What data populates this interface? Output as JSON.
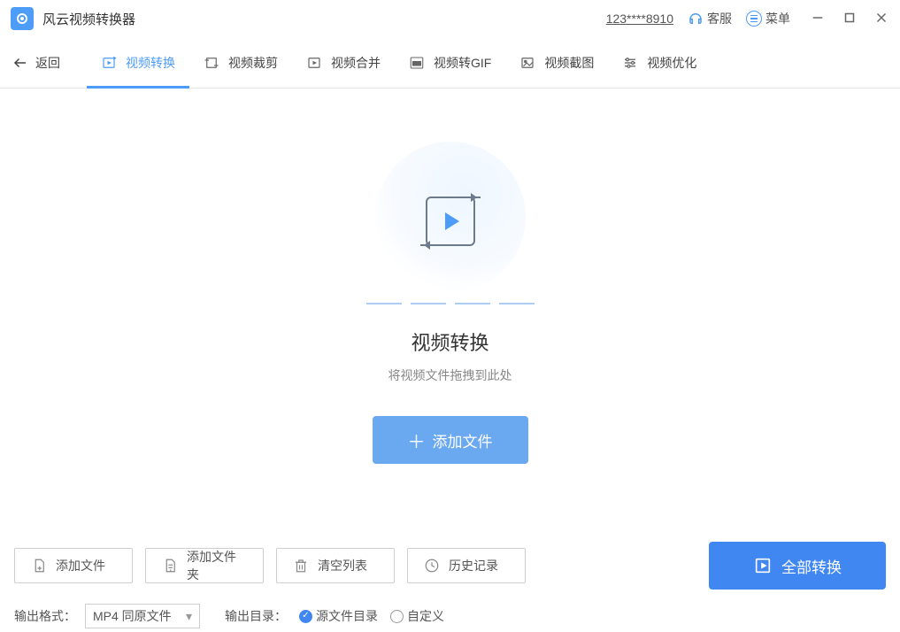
{
  "titlebar": {
    "app_name": "风云视频转换器",
    "account": "123****8910",
    "support": "客服",
    "menu": "菜单"
  },
  "tabs": {
    "back": "返回",
    "items": [
      {
        "label": "视频转换",
        "active": true
      },
      {
        "label": "视频裁剪"
      },
      {
        "label": "视频合并"
      },
      {
        "label": "视频转GIF"
      },
      {
        "label": "视频截图"
      },
      {
        "label": "视频优化"
      }
    ]
  },
  "hero": {
    "title": "视频转换",
    "subtitle": "将视频文件拖拽到此处",
    "add_button": "添加文件"
  },
  "bottom": {
    "add_file": "添加文件",
    "add_folder": "添加文件夹",
    "clear_list": "清空列表",
    "history": "历史记录",
    "convert_all": "全部转换",
    "output_format_label": "输出格式：",
    "output_format_value": "MP4 同原文件",
    "output_dir_label": "输出目录：",
    "radio_source": "源文件目录",
    "radio_custom": "自定义"
  }
}
